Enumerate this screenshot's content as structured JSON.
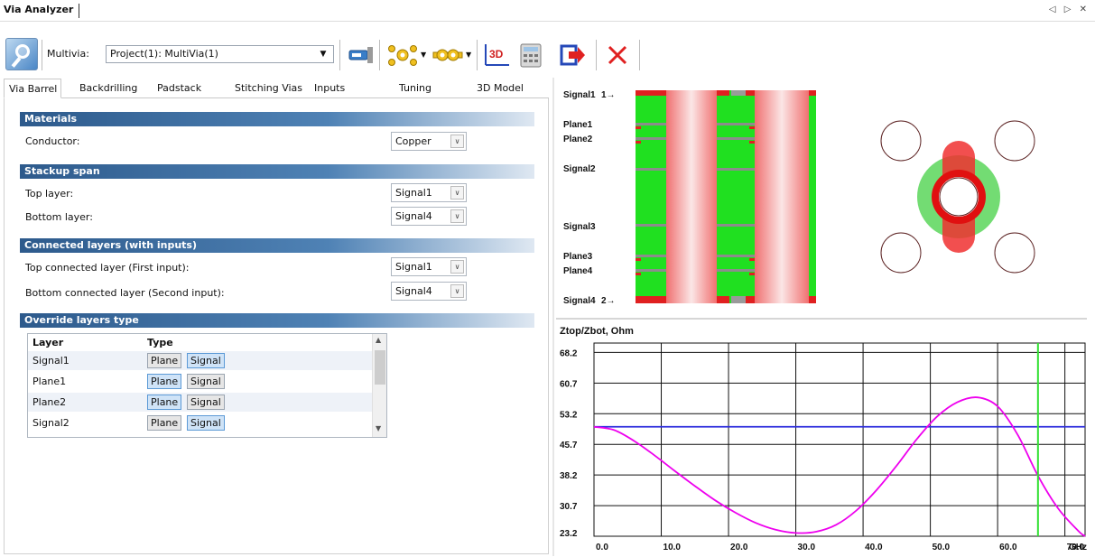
{
  "window": {
    "title": "Via Analyzer",
    "controls": "◁ ▷ ✕"
  },
  "toolbar": {
    "multivia_label": "Multivia:",
    "multivia_value": "Project(1): MultiVia(1)",
    "icons": [
      "analyzer-icon",
      "probe-icon",
      "via-pattern-icon",
      "via-chain-icon",
      "3d-view-icon",
      "calculator-icon",
      "export-icon",
      "close-red-icon"
    ]
  },
  "tabs": [
    "Via Barrel",
    "Backdrilling",
    "Padstack",
    "Stitching Vias",
    "Inputs",
    "Tuning",
    "3D Model"
  ],
  "active_tab": "Via Barrel",
  "form": {
    "materials": {
      "header": "Materials",
      "conductor_label": "Conductor:",
      "conductor_value": "Copper"
    },
    "stackup_span": {
      "header": "Stackup span",
      "top_label": "Top layer:",
      "top_value": "Signal1",
      "bottom_label": "Bottom layer:",
      "bottom_value": "Signal4"
    },
    "connected": {
      "header": "Connected layers (with inputs)",
      "top_label": "Top connected layer (First input):",
      "top_value": "Signal1",
      "bottom_label": "Bottom connected layer (Second input):",
      "bottom_value": "Signal4"
    },
    "override": {
      "header": "Override layers type",
      "col_layer": "Layer",
      "col_type": "Type",
      "btn_plane": "Plane",
      "btn_signal": "Signal",
      "rows": [
        {
          "name": "Signal1",
          "selected": "Signal"
        },
        {
          "name": "Plane1",
          "selected": "Plane"
        },
        {
          "name": "Plane2",
          "selected": "Plane"
        },
        {
          "name": "Signal2",
          "selected": "Signal"
        }
      ]
    }
  },
  "stackup": {
    "labels": [
      "Signal1",
      "Plane1",
      "Plane2",
      "Signal2",
      "Signal3",
      "Plane3",
      "Plane4",
      "Signal4"
    ],
    "port_top": "1→",
    "port_bottom": "2→"
  },
  "chart_data": {
    "type": "line",
    "title": "Ztop/Zbot, Ohm",
    "xlabel": "GHz",
    "xlim": [
      0,
      73
    ],
    "ylim": [
      23.2,
      70.5
    ],
    "x_ticks": [
      "0.0",
      "10.0",
      "20.0",
      "30.0",
      "40.0",
      "50.0",
      "60.0",
      "70.0"
    ],
    "y_ticks": [
      "68.2",
      "60.7",
      "53.2",
      "45.7",
      "38.2",
      "30.7",
      "23.2"
    ],
    "cursor_x": 66,
    "series": [
      {
        "color": "#2f2fdd",
        "x": [
          0,
          73
        ],
        "y": [
          50,
          50
        ]
      },
      {
        "color": "#ee00ee",
        "x": [
          0,
          3,
          6,
          9,
          12,
          15,
          18,
          21,
          24,
          27,
          30,
          33,
          36,
          39,
          42,
          45,
          48,
          51,
          54,
          57,
          60,
          63,
          66,
          69,
          72,
          73
        ],
        "y": [
          50,
          49.2,
          46.5,
          43,
          39.2,
          35.5,
          32,
          29,
          26.5,
          24.8,
          24,
          24.3,
          26,
          29.5,
          34.5,
          40.5,
          47,
          52.5,
          56,
          57.2,
          55,
          48,
          38,
          30,
          24.5,
          23.2
        ]
      }
    ]
  }
}
